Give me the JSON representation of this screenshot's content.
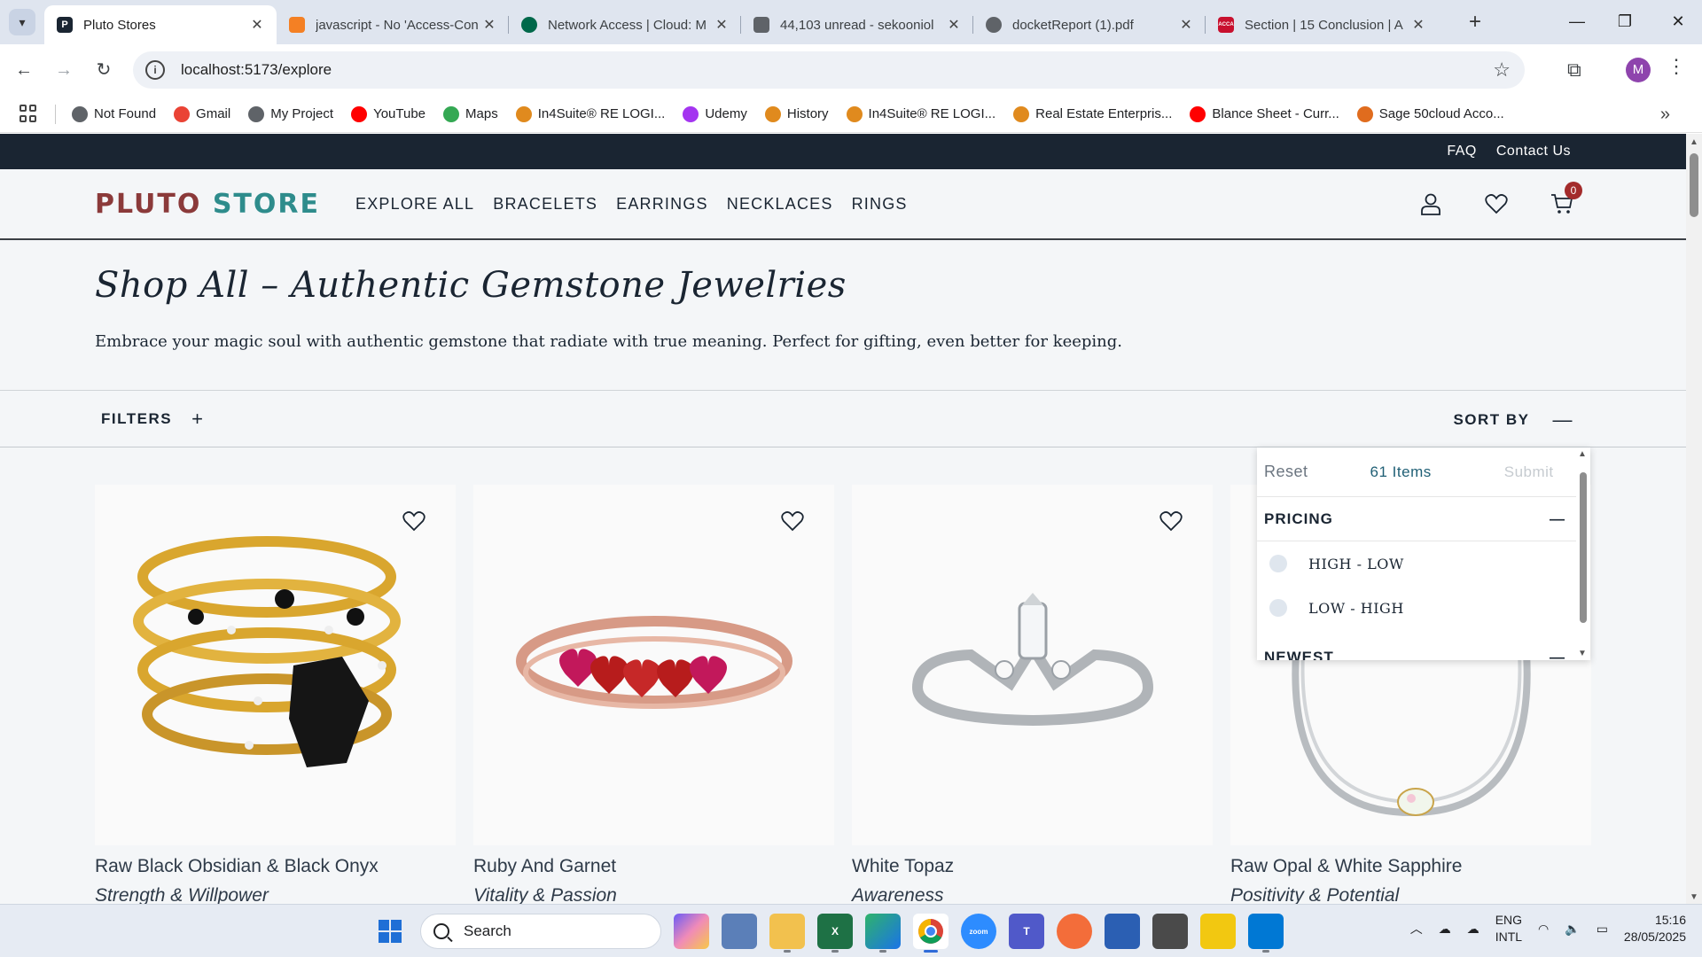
{
  "browser": {
    "tabs": [
      {
        "title": "Pluto Stores",
        "favicon": "P",
        "color": "#1a2532",
        "active": true
      },
      {
        "title": "javascript - No 'Access-Con",
        "favicon": "",
        "color": "#f48024",
        "active": false
      },
      {
        "title": "Network Access | Cloud: M",
        "favicon": "",
        "color": "#00684a",
        "active": false
      },
      {
        "title": "44,103 unread - sekooniol",
        "favicon": "",
        "color": "#5f6368",
        "active": false
      },
      {
        "title": "docketReport (1).pdf",
        "favicon": "",
        "color": "#5f6368",
        "active": false
      },
      {
        "title": "Section | 15 Conclusion | A",
        "favicon": "ACCA",
        "color": "#c8102e",
        "active": false
      }
    ],
    "url": "localhost:5173/explore",
    "profile_initial": "M",
    "bookmarks": [
      {
        "label": "Not Found",
        "icon": "globe-icon",
        "color": "#5f6368"
      },
      {
        "label": "Gmail",
        "icon": "gmail-icon",
        "color": "#ea4335"
      },
      {
        "label": "My Project",
        "icon": "globe-icon",
        "color": "#5f6368"
      },
      {
        "label": "YouTube",
        "icon": "youtube-icon",
        "color": "#ff0000"
      },
      {
        "label": "Maps",
        "icon": "maps-icon",
        "color": "#34a853"
      },
      {
        "label": "In4Suite® RE LOGI...",
        "icon": "in4suite-icon",
        "color": "#e08a1e"
      },
      {
        "label": "Udemy",
        "icon": "udemy-icon",
        "color": "#a435f0"
      },
      {
        "label": "History",
        "icon": "in4suite-icon",
        "color": "#e08a1e"
      },
      {
        "label": "In4Suite® RE LOGI...",
        "icon": "in4suite-icon",
        "color": "#e08a1e"
      },
      {
        "label": "Real Estate Enterpris...",
        "icon": "in4suite-icon",
        "color": "#e08a1e"
      },
      {
        "label": "Blance Sheet - Curr...",
        "icon": "youtube-icon",
        "color": "#ff0000"
      },
      {
        "label": "Sage 50cloud Acco...",
        "icon": "sage-icon",
        "color": "#e06c1e"
      }
    ]
  },
  "site": {
    "topbar": {
      "faq": "FAQ",
      "contact": "Contact Us"
    },
    "logo": {
      "part1": "PLUTO",
      "part2": "STORE"
    },
    "nav": [
      "EXPLORE ALL",
      "BRACELETS",
      "EARRINGS",
      "NECKLACES",
      "RINGS"
    ],
    "cart_count": "0",
    "hero": {
      "title": "Shop All – Authentic Gemstone Jewelries",
      "subtitle": "Embrace your magic soul with authentic gemstone that radiate with true meaning. Perfect for gifting, even better for keeping."
    },
    "filters_label": "FILTERS",
    "sortby_label": "SORT BY",
    "sort_panel": {
      "reset": "Reset",
      "count": "61 Items",
      "submit": "Submit",
      "pricing_label": "PRICING",
      "options": [
        "HIGH - LOW",
        "LOW - HIGH"
      ],
      "newest_label": "NEWEST"
    },
    "products": [
      {
        "name": "Raw Black Obsidian & Black Onyx",
        "tag": "Strength & Willpower"
      },
      {
        "name": "Ruby And Garnet",
        "tag": "Vitality & Passion"
      },
      {
        "name": "White Topaz",
        "tag": "Awareness"
      },
      {
        "name": "Raw Opal & White Sapphire",
        "tag": "Positivity & Potential"
      }
    ]
  },
  "taskbar": {
    "search_label": "Search",
    "lang_top": "ENG",
    "lang_bottom": "INTL",
    "time": "15:16",
    "date": "28/05/2025"
  }
}
